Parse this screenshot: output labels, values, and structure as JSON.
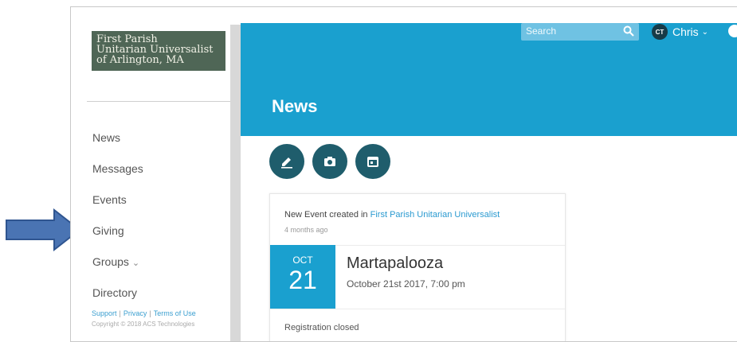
{
  "colors": {
    "banner": "#1aa0cf",
    "action_button": "#1f5d6c",
    "logo_bg": "#4f6656",
    "arrow": "#4a74b3",
    "link": "#2a9ad0"
  },
  "logo": {
    "lines": [
      "First Parish",
      "Unitarian Universalist",
      "of Arlington, MA"
    ]
  },
  "sidebar": {
    "items": [
      {
        "label": "News"
      },
      {
        "label": "Messages"
      },
      {
        "label": "Events"
      },
      {
        "label": "Giving"
      },
      {
        "label": "Groups",
        "icon": "chevron-down-icon"
      },
      {
        "label": "Directory"
      }
    ],
    "footer": {
      "support": "Support",
      "privacy": "Privacy",
      "terms": "Terms of Use",
      "copyright": "Copyright © 2018 ACS Technologies"
    }
  },
  "header": {
    "search_placeholder": "Search",
    "search_icon": "search-icon",
    "user": {
      "initials": "CT",
      "name": "Chris",
      "icon": "chevron-down-icon"
    }
  },
  "page": {
    "title": "News"
  },
  "actions": [
    {
      "name": "compose",
      "icon": "pencil-icon"
    },
    {
      "name": "photo",
      "icon": "camera-icon"
    },
    {
      "name": "event",
      "icon": "calendar-icon"
    }
  ],
  "post": {
    "prefix": "New Event created in ",
    "group_link": "First Parish Unitarian Universalist",
    "time": "4 months ago",
    "event": {
      "month": "OCT",
      "day": "21",
      "title": "Martapalooza",
      "date": "October 21st 2017, 7:00 pm"
    },
    "status": "Registration closed"
  },
  "annotation": {
    "icon": "right-arrow-icon",
    "points_to": "Giving"
  }
}
